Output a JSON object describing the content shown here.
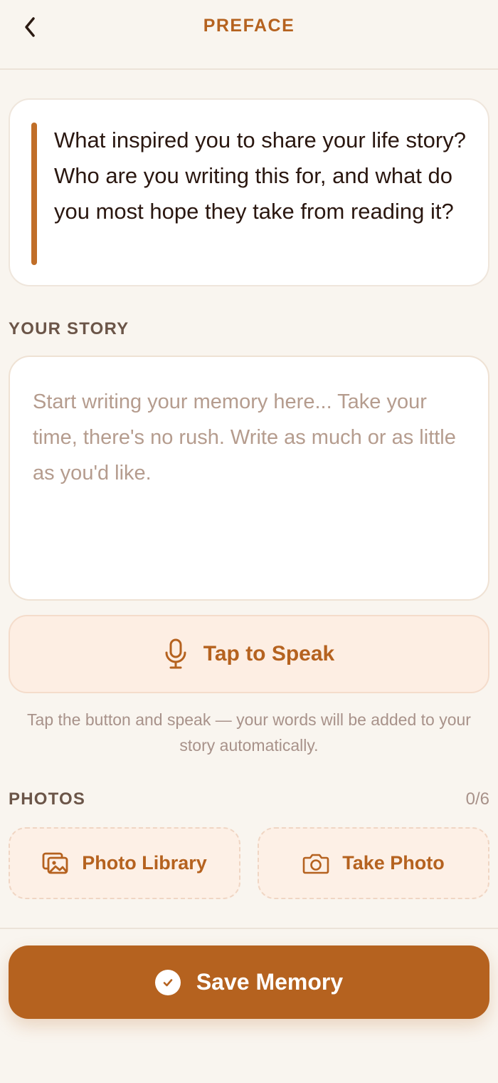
{
  "header": {
    "title": "PREFACE",
    "back_icon": "chevron-left-icon"
  },
  "prompt": {
    "text": "What inspired you to share your life story? Who are you writing this for, and what do you most hope they take from reading it?"
  },
  "story": {
    "section_label": "YOUR STORY",
    "value": "",
    "placeholder": "Start writing your memory here... Take your time, there's no rush. Write as much or as little as you'd like."
  },
  "speak": {
    "label": "Tap to Speak",
    "icon": "microphone-icon",
    "hint": "Tap the button and speak — your words will be added to your story automatically."
  },
  "photos": {
    "section_label": "PHOTOS",
    "count": "0/6",
    "library_label": "Photo Library",
    "library_icon": "photo-library-icon",
    "camera_label": "Take Photo",
    "camera_icon": "camera-icon"
  },
  "save": {
    "label": "Save Memory",
    "icon": "check-circle-icon"
  },
  "colors": {
    "accent": "#b5621f",
    "background": "#f9f5ef",
    "speak_bg": "#fdeee3",
    "placeholder": "#b59c8e"
  }
}
